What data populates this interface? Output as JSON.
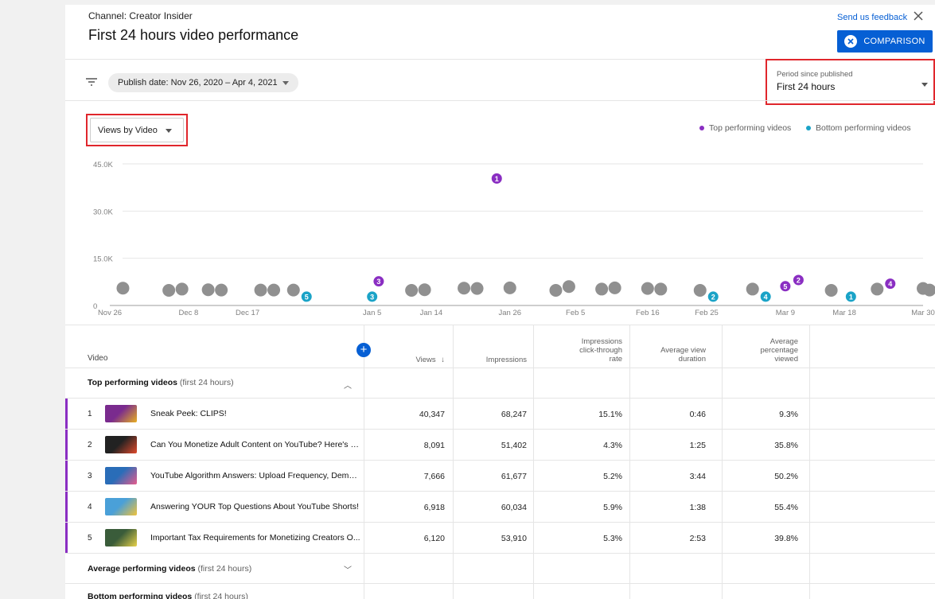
{
  "header": {
    "channel": "Channel: Creator Insider",
    "title": "First 24 hours video performance",
    "feedback": "Send us feedback",
    "comparison_button": "COMPARISON"
  },
  "filters": {
    "publish_date_chip": "Publish date: Nov 26, 2020 – Apr 4, 2021",
    "period_label": "Period since published",
    "period_value": "First 24 hours",
    "metric_select": "Views by Video"
  },
  "legend": {
    "top": "Top performing videos",
    "bottom": "Bottom performing videos"
  },
  "colors": {
    "top": "#8a2ec2",
    "bottom": "#1aa3c7",
    "average": "#909090",
    "accent": "#065fd4",
    "highlight": "#e0262c"
  },
  "chart_data": {
    "type": "scatter",
    "y_ticks": [
      "45.0K",
      "30.0K",
      "15.0K",
      "0"
    ],
    "ylim": [
      0,
      45000
    ],
    "x_ticks": [
      "Nov 26",
      "Dec 8",
      "Dec 17",
      "Jan 5",
      "Jan 14",
      "Jan 26",
      "Feb 5",
      "Feb 16",
      "Feb 25",
      "Mar 9",
      "Mar 18",
      "Mar 30"
    ],
    "series": [
      {
        "name": "Top performing videos",
        "points": [
          {
            "x": "Jan 24",
            "y": 40347,
            "label": "1"
          },
          {
            "x": "Mar 11",
            "y": 8091,
            "label": "2"
          },
          {
            "x": "Jan 6",
            "y": 7666,
            "label": "3"
          },
          {
            "x": "Mar 25",
            "y": 6918,
            "label": "4"
          },
          {
            "x": "Mar 9",
            "y": 6120,
            "label": "5"
          }
        ]
      },
      {
        "name": "Bottom performing videos",
        "points": [
          {
            "x": "Feb 26",
            "y": 2800,
            "label": "2"
          },
          {
            "x": "Jan 5",
            "y": 2800,
            "label": "3"
          },
          {
            "x": "Mar 6",
            "y": 2800,
            "label": "4"
          },
          {
            "x": "Dec 26",
            "y": 2800,
            "label": "5"
          },
          {
            "x": "Mar 19",
            "y": 2800,
            "label": "1"
          }
        ]
      },
      {
        "name": "",
        "points": [
          {
            "x": "Nov 28",
            "y": 5500
          },
          {
            "x": "Dec 5",
            "y": 4800
          },
          {
            "x": "Dec 7",
            "y": 5200
          },
          {
            "x": "Dec 11",
            "y": 5000
          },
          {
            "x": "Dec 13",
            "y": 4900
          },
          {
            "x": "Dec 19",
            "y": 4900
          },
          {
            "x": "Dec 21",
            "y": 4900
          },
          {
            "x": "Dec 24",
            "y": 4900
          },
          {
            "x": "Jan 11",
            "y": 4800
          },
          {
            "x": "Jan 13",
            "y": 5000
          },
          {
            "x": "Jan 19",
            "y": 5500
          },
          {
            "x": "Jan 21",
            "y": 5400
          },
          {
            "x": "Jan 26",
            "y": 5600
          },
          {
            "x": "Feb 2",
            "y": 4800
          },
          {
            "x": "Feb 4",
            "y": 6000
          },
          {
            "x": "Feb 9",
            "y": 5200
          },
          {
            "x": "Feb 11",
            "y": 5600
          },
          {
            "x": "Feb 16",
            "y": 5400
          },
          {
            "x": "Feb 18",
            "y": 5200
          },
          {
            "x": "Feb 24",
            "y": 4800
          },
          {
            "x": "Mar 4",
            "y": 5200
          },
          {
            "x": "Mar 16",
            "y": 4800
          },
          {
            "x": "Mar 23",
            "y": 5200
          },
          {
            "x": "Mar 30",
            "y": 5400
          },
          {
            "x": "Mar 31",
            "y": 4900
          }
        ]
      }
    ]
  },
  "table": {
    "headers": {
      "video": "Video",
      "views": "Views",
      "impressions": "Impressions",
      "ctr_1": "Impressions",
      "ctr_2": "click-through",
      "ctr_3": "rate",
      "avd_1": "Average view",
      "avd_2": "duration",
      "apv_1": "Average",
      "apv_2": "percentage",
      "apv_3": "viewed"
    },
    "groups": {
      "top_title": "Top performing videos",
      "top_sub": "(first 24 hours)",
      "avg_title": "Average performing videos",
      "avg_sub": "(first 24 hours)",
      "bottom_title": "Bottom performing videos",
      "bottom_sub": "(first 24 hours)"
    },
    "rows": [
      {
        "rank": "1",
        "title": "Sneak Peek: CLIPS!",
        "views": "40,347",
        "impressions": "68,247",
        "ctr": "15.1%",
        "avd": "0:46",
        "apv": "9.3%"
      },
      {
        "rank": "2",
        "title": "Can You Monetize Adult Content on YouTube? Here's Ev...",
        "views": "8,091",
        "impressions": "51,402",
        "ctr": "4.3%",
        "avd": "1:25",
        "apv": "35.8%"
      },
      {
        "rank": "3",
        "title": "YouTube Algorithm Answers: Upload Frequency, Demon...",
        "views": "7,666",
        "impressions": "61,677",
        "ctr": "5.2%",
        "avd": "3:44",
        "apv": "50.2%"
      },
      {
        "rank": "4",
        "title": "Answering YOUR Top Questions About YouTube Shorts!",
        "views": "6,918",
        "impressions": "60,034",
        "ctr": "5.9%",
        "avd": "1:38",
        "apv": "55.4%"
      },
      {
        "rank": "5",
        "title": "Important Tax Requirements for Monetizing Creators O...",
        "views": "6,120",
        "impressions": "53,910",
        "ctr": "5.3%",
        "avd": "2:53",
        "apv": "39.8%"
      }
    ]
  }
}
